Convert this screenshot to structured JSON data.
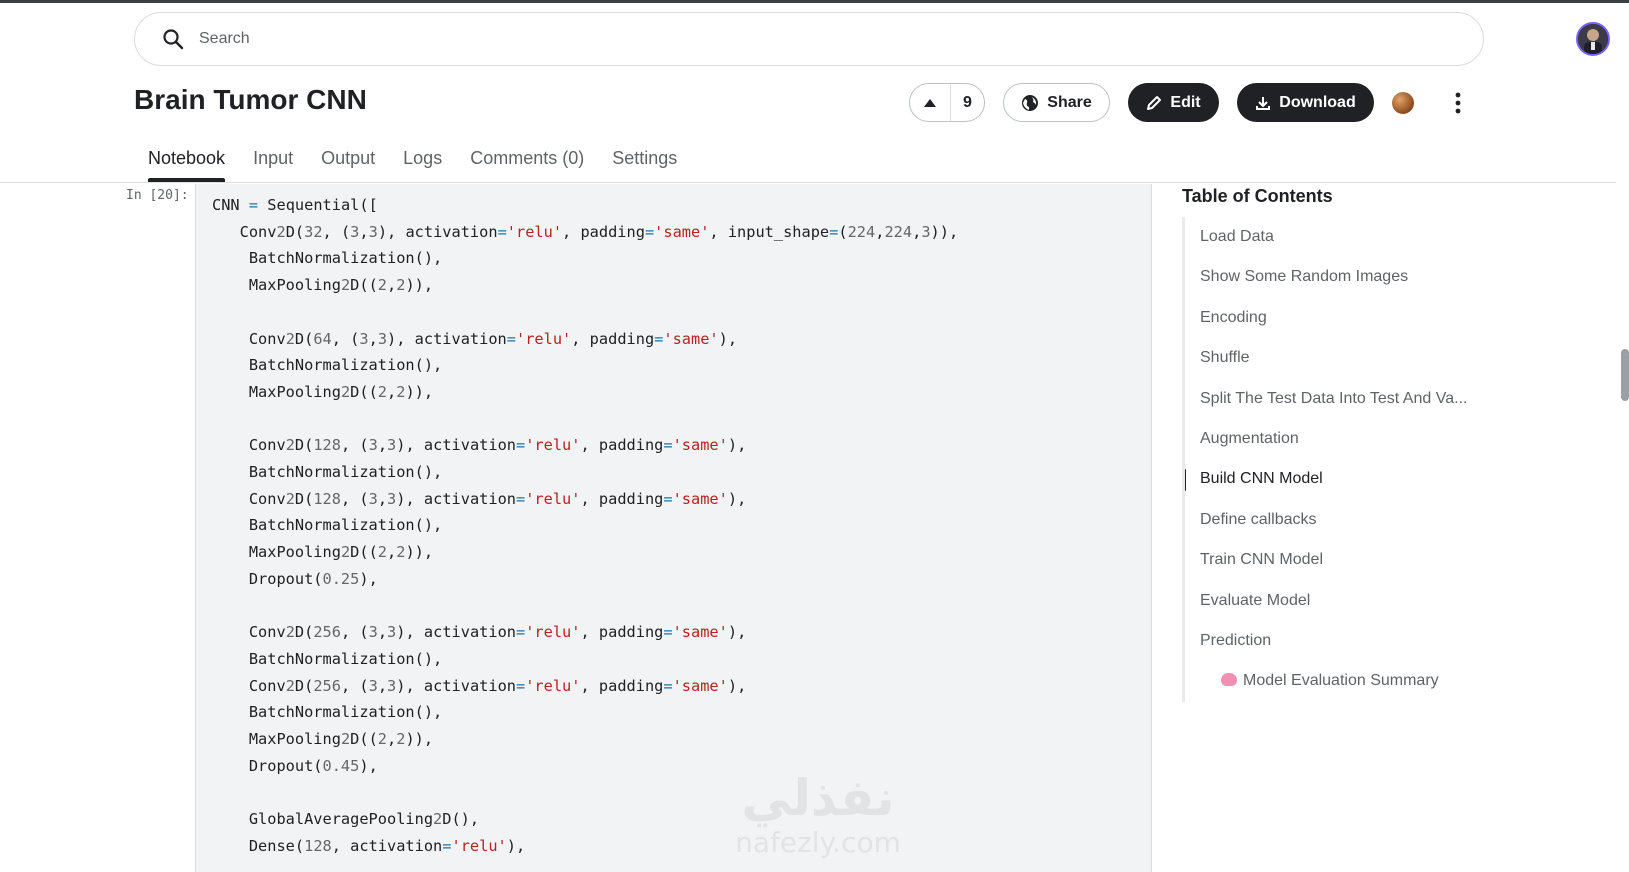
{
  "search": {
    "placeholder": "Search"
  },
  "notebook": {
    "title": "Brain Tumor CNN",
    "vote_count": "9",
    "share_label": "Share",
    "edit_label": "Edit",
    "download_label": "Download"
  },
  "tabs": [
    {
      "label": "Notebook",
      "active": true
    },
    {
      "label": "Input"
    },
    {
      "label": "Output"
    },
    {
      "label": "Logs"
    },
    {
      "label": "Comments (0)"
    },
    {
      "label": "Settings"
    }
  ],
  "cell": {
    "prompt": "In [20]:",
    "code_lines": [
      "CNN = Sequential([",
      "   Conv2D(32, (3,3), activation='relu', padding='same', input_shape=(224,224,3)),",
      "    BatchNormalization(),",
      "    MaxPooling2D((2,2)),",
      "",
      "    Conv2D(64, (3,3), activation='relu', padding='same'),",
      "    BatchNormalization(),",
      "    MaxPooling2D((2,2)),",
      "",
      "    Conv2D(128, (3,3), activation='relu', padding='same'),",
      "    BatchNormalization(),",
      "    Conv2D(128, (3,3), activation='relu', padding='same'),",
      "    BatchNormalization(),",
      "    MaxPooling2D((2,2)),",
      "    Dropout(0.25),",
      "",
      "    Conv2D(256, (3,3), activation='relu', padding='same'),",
      "    BatchNormalization(),",
      "    Conv2D(256, (3,3), activation='relu', padding='same'),",
      "    BatchNormalization(),",
      "    MaxPooling2D((2,2)),",
      "    Dropout(0.45),",
      "",
      "    GlobalAveragePooling2D(),",
      "    Dense(128, activation='relu'),"
    ]
  },
  "watermark": {
    "arabic": "نفذلي",
    "latin": "nafezly.com"
  },
  "toc": {
    "title": "Table of Contents",
    "items": [
      {
        "label": "Load Data"
      },
      {
        "label": "Show Some Random Images"
      },
      {
        "label": "Encoding"
      },
      {
        "label": "Shuffle"
      },
      {
        "label": "Split The Test Data Into Test And Va..."
      },
      {
        "label": "Augmentation"
      },
      {
        "label": "Build CNN Model",
        "active": true
      },
      {
        "label": "Define callbacks"
      },
      {
        "label": "Train CNN Model"
      },
      {
        "label": "Evaluate Model"
      },
      {
        "label": "Prediction"
      },
      {
        "label": "Model Evaluation Summary",
        "sub": true,
        "icon": "brain-icon"
      }
    ]
  },
  "colors": {
    "number": "#666666",
    "string": "#ba2121",
    "operator": "#1a73a8",
    "accent_dark": "#202124"
  }
}
